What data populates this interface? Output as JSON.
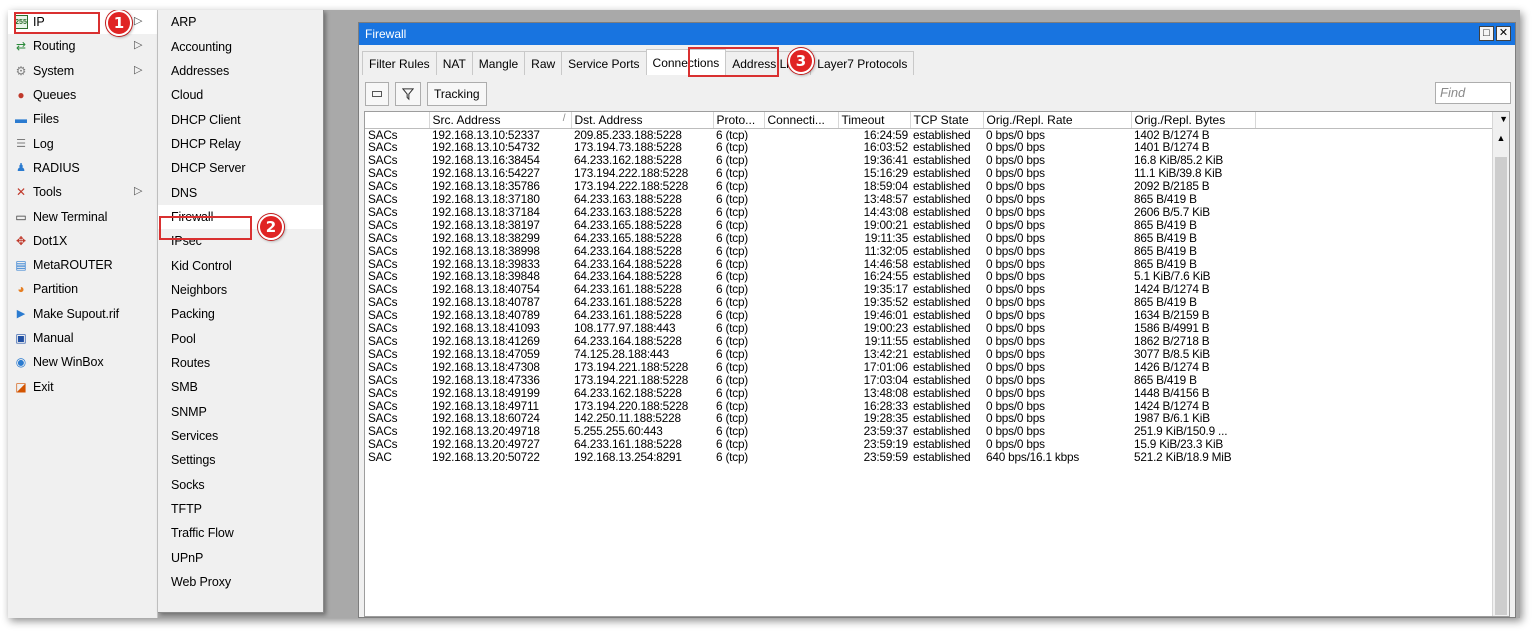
{
  "main_menu": [
    {
      "label": "IP",
      "icon": "ip-icon",
      "has_arrow": true
    },
    {
      "label": "Routing",
      "icon": "routing-icon",
      "has_arrow": true
    },
    {
      "label": "System",
      "icon": "system-icon",
      "has_arrow": true
    },
    {
      "label": "Queues",
      "icon": "queues-icon",
      "has_arrow": false
    },
    {
      "label": "Files",
      "icon": "files-icon",
      "has_arrow": false
    },
    {
      "label": "Log",
      "icon": "log-icon",
      "has_arrow": false
    },
    {
      "label": "RADIUS",
      "icon": "radius-icon",
      "has_arrow": false
    },
    {
      "label": "Tools",
      "icon": "tools-icon",
      "has_arrow": true
    },
    {
      "label": "New Terminal",
      "icon": "terminal-icon",
      "has_arrow": false
    },
    {
      "label": "Dot1X",
      "icon": "dot1x-icon",
      "has_arrow": false
    },
    {
      "label": "MetaROUTER",
      "icon": "metarouter-icon",
      "has_arrow": false
    },
    {
      "label": "Partition",
      "icon": "partition-icon",
      "has_arrow": false
    },
    {
      "label": "Make Supout.rif",
      "icon": "supout-icon",
      "has_arrow": false
    },
    {
      "label": "Manual",
      "icon": "manual-icon",
      "has_arrow": false
    },
    {
      "label": "New WinBox",
      "icon": "winbox-icon",
      "has_arrow": false
    },
    {
      "label": "Exit",
      "icon": "exit-icon",
      "has_arrow": false
    }
  ],
  "sub_menu": [
    "ARP",
    "Accounting",
    "Addresses",
    "Cloud",
    "DHCP Client",
    "DHCP Relay",
    "DHCP Server",
    "DNS",
    "Firewall",
    "IPsec",
    "Kid Control",
    "Neighbors",
    "Packing",
    "Pool",
    "Routes",
    "SMB",
    "SNMP",
    "Services",
    "Settings",
    "Socks",
    "TFTP",
    "Traffic Flow",
    "UPnP",
    "Web Proxy"
  ],
  "callouts": {
    "one": "1",
    "two": "2",
    "three": "3"
  },
  "window": {
    "title": "Firewall",
    "tabs": [
      "Filter Rules",
      "NAT",
      "Mangle",
      "Raw",
      "Service Ports",
      "Connections",
      "Address Lists",
      "Layer7 Protocols"
    ],
    "active_tab": "Connections",
    "toolbar": {
      "tracking_label": "Tracking",
      "find_placeholder": "Find"
    }
  },
  "table": {
    "columns": [
      "",
      "Src. Address",
      "Dst. Address",
      "Proto...",
      "Connecti...",
      "Timeout",
      "TCP State",
      "Orig./Repl. Rate",
      "Orig./Repl. Bytes"
    ],
    "rows": [
      [
        "SACs",
        "192.168.13.10:52337",
        "209.85.233.188:5228",
        "6 (tcp)",
        "",
        "16:24:59",
        "established",
        "0 bps/0 bps",
        "1402 B/1274 B"
      ],
      [
        "SACs",
        "192.168.13.10:54732",
        "173.194.73.188:5228",
        "6 (tcp)",
        "",
        "16:03:52",
        "established",
        "0 bps/0 bps",
        "1401 B/1274 B"
      ],
      [
        "SACs",
        "192.168.13.16:38454",
        "64.233.162.188:5228",
        "6 (tcp)",
        "",
        "19:36:41",
        "established",
        "0 bps/0 bps",
        "16.8 KiB/85.2 KiB"
      ],
      [
        "SACs",
        "192.168.13.16:54227",
        "173.194.222.188:5228",
        "6 (tcp)",
        "",
        "15:16:29",
        "established",
        "0 bps/0 bps",
        "11.1 KiB/39.8 KiB"
      ],
      [
        "SACs",
        "192.168.13.18:35786",
        "173.194.222.188:5228",
        "6 (tcp)",
        "",
        "18:59:04",
        "established",
        "0 bps/0 bps",
        "2092 B/2185 B"
      ],
      [
        "SACs",
        "192.168.13.18:37180",
        "64.233.163.188:5228",
        "6 (tcp)",
        "",
        "13:48:57",
        "established",
        "0 bps/0 bps",
        "865 B/419 B"
      ],
      [
        "SACs",
        "192.168.13.18:37184",
        "64.233.163.188:5228",
        "6 (tcp)",
        "",
        "14:43:08",
        "established",
        "0 bps/0 bps",
        "2606 B/5.7 KiB"
      ],
      [
        "SACs",
        "192.168.13.18:38197",
        "64.233.165.188:5228",
        "6 (tcp)",
        "",
        "19:00:21",
        "established",
        "0 bps/0 bps",
        "865 B/419 B"
      ],
      [
        "SACs",
        "192.168.13.18:38299",
        "64.233.165.188:5228",
        "6 (tcp)",
        "",
        "19:11:35",
        "established",
        "0 bps/0 bps",
        "865 B/419 B"
      ],
      [
        "SACs",
        "192.168.13.18:38998",
        "64.233.164.188:5228",
        "6 (tcp)",
        "",
        "11:32:05",
        "established",
        "0 bps/0 bps",
        "865 B/419 B"
      ],
      [
        "SACs",
        "192.168.13.18:39833",
        "64.233.164.188:5228",
        "6 (tcp)",
        "",
        "14:46:58",
        "established",
        "0 bps/0 bps",
        "865 B/419 B"
      ],
      [
        "SACs",
        "192.168.13.18:39848",
        "64.233.164.188:5228",
        "6 (tcp)",
        "",
        "16:24:55",
        "established",
        "0 bps/0 bps",
        "5.1 KiB/7.6 KiB"
      ],
      [
        "SACs",
        "192.168.13.18:40754",
        "64.233.161.188:5228",
        "6 (tcp)",
        "",
        "19:35:17",
        "established",
        "0 bps/0 bps",
        "1424 B/1274 B"
      ],
      [
        "SACs",
        "192.168.13.18:40787",
        "64.233.161.188:5228",
        "6 (tcp)",
        "",
        "19:35:52",
        "established",
        "0 bps/0 bps",
        "865 B/419 B"
      ],
      [
        "SACs",
        "192.168.13.18:40789",
        "64.233.161.188:5228",
        "6 (tcp)",
        "",
        "19:46:01",
        "established",
        "0 bps/0 bps",
        "1634 B/2159 B"
      ],
      [
        "SACs",
        "192.168.13.18:41093",
        "108.177.97.188:443",
        "6 (tcp)",
        "",
        "19:00:23",
        "established",
        "0 bps/0 bps",
        "1586 B/4991 B"
      ],
      [
        "SACs",
        "192.168.13.18:41269",
        "64.233.164.188:5228",
        "6 (tcp)",
        "",
        "19:11:55",
        "established",
        "0 bps/0 bps",
        "1862 B/2718 B"
      ],
      [
        "SACs",
        "192.168.13.18:47059",
        "74.125.28.188:443",
        "6 (tcp)",
        "",
        "13:42:21",
        "established",
        "0 bps/0 bps",
        "3077 B/8.5 KiB"
      ],
      [
        "SACs",
        "192.168.13.18:47308",
        "173.194.221.188:5228",
        "6 (tcp)",
        "",
        "17:01:06",
        "established",
        "0 bps/0 bps",
        "1426 B/1274 B"
      ],
      [
        "SACs",
        "192.168.13.18:47336",
        "173.194.221.188:5228",
        "6 (tcp)",
        "",
        "17:03:04",
        "established",
        "0 bps/0 bps",
        "865 B/419 B"
      ],
      [
        "SACs",
        "192.168.13.18:49199",
        "64.233.162.188:5228",
        "6 (tcp)",
        "",
        "13:48:08",
        "established",
        "0 bps/0 bps",
        "1448 B/4156 B"
      ],
      [
        "SACs",
        "192.168.13.18:49711",
        "173.194.220.188:5228",
        "6 (tcp)",
        "",
        "16:28:33",
        "established",
        "0 bps/0 bps",
        "1424 B/1274 B"
      ],
      [
        "SACs",
        "192.168.13.18:60724",
        "142.250.11.188:5228",
        "6 (tcp)",
        "",
        "19:28:35",
        "established",
        "0 bps/0 bps",
        "1987 B/6.1 KiB"
      ],
      [
        "SACs",
        "192.168.13.20:49718",
        "5.255.255.60:443",
        "6 (tcp)",
        "",
        "23:59:37",
        "established",
        "0 bps/0 bps",
        "251.9 KiB/150.9 ..."
      ],
      [
        "SACs",
        "192.168.13.20:49727",
        "64.233.161.188:5228",
        "6 (tcp)",
        "",
        "23:59:19",
        "established",
        "0 bps/0 bps",
        "15.9 KiB/23.3 KiB"
      ],
      [
        "SAC",
        "192.168.13.20:50722",
        "192.168.13.254:8291",
        "6 (tcp)",
        "",
        "23:59:59",
        "established",
        "640 bps/16.1 kbps",
        "521.2 KiB/18.9 MiB"
      ]
    ]
  },
  "colors": {
    "title_bar": "#1874e0",
    "highlight": "#d93030",
    "badge": "#e02424",
    "menu_bg": "#f0f0f0"
  }
}
